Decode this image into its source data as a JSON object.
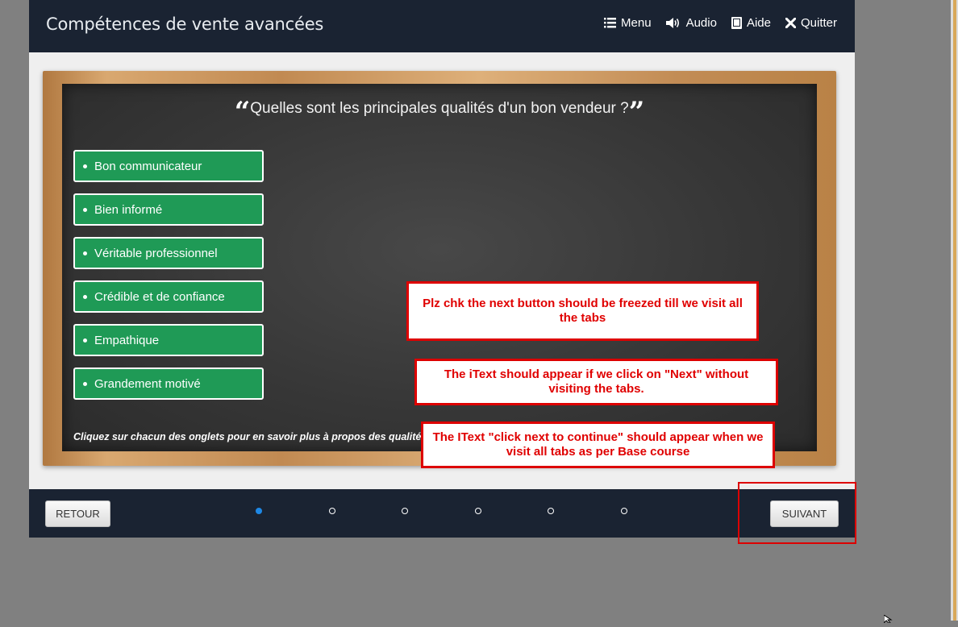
{
  "header": {
    "title": "Compétences de vente avancées",
    "nav": [
      {
        "label": "Menu",
        "icon": "menu-icon"
      },
      {
        "label": "Audio",
        "icon": "speaker-icon"
      },
      {
        "label": "Aide",
        "icon": "book-icon"
      },
      {
        "label": "Quitter",
        "icon": "close-icon"
      }
    ]
  },
  "board": {
    "question": "Quelles sont les principales qualités d'un bon vendeur ?",
    "quote_open": "“",
    "quote_close": "”",
    "tabs": [
      "Bon communicateur",
      "Bien informé",
      "Véritable professionnel",
      "Crédible et de confiance",
      "Empathique",
      "Grandement motivé"
    ],
    "instruction": "Cliquez sur chacun des onglets pour en savoir plus à propos des qualités d"
  },
  "annotations": [
    "Plz chk the next button should be freezed till we visit all the tabs",
    "The iText should appear if we click on \"Next\" without visiting the tabs.",
    "The IText \"click next to continue\" should appear when we visit all tabs as per Base course"
  ],
  "footer": {
    "back_label": "RETOUR",
    "next_label": "SUIVANT",
    "pages_total": 6,
    "current_page": 1
  },
  "colors": {
    "header_bg": "#1a2332",
    "tab_green": "#1f9a56",
    "annotation_red": "#dd0000",
    "active_dot": "#1e88e5"
  }
}
